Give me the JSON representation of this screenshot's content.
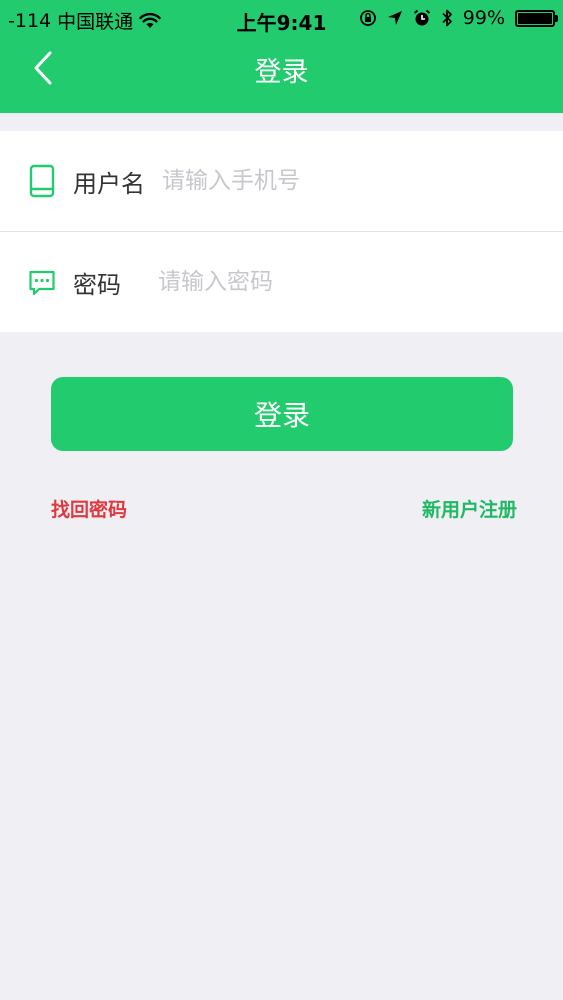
{
  "status_bar": {
    "signal": "-114",
    "carrier": "中国联通",
    "time": "上午9:41",
    "battery_percent": "99%",
    "battery_level": 0.99
  },
  "nav": {
    "title": "登录",
    "back_icon": "chevron-left-icon"
  },
  "form": {
    "username": {
      "icon": "phone-icon",
      "label": "用户名",
      "placeholder": "请输入手机号",
      "value": ""
    },
    "password": {
      "icon": "message-icon",
      "label": "密码",
      "placeholder": "请输入密码",
      "value": ""
    }
  },
  "actions": {
    "login_label": "登录",
    "forgot_label": "找回密码",
    "register_label": "新用户注册"
  },
  "colors": {
    "brand": "#22cc6e",
    "background": "#efeff4",
    "forgot": "#e0383e",
    "register": "#1fb863"
  }
}
